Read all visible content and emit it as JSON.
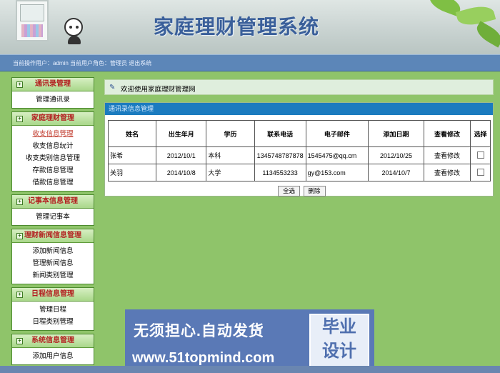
{
  "header": {
    "title": "家庭理财管理系统"
  },
  "status_bar": {
    "text": "当前操作用户：admin 当前用户角色：管理员 退出系统"
  },
  "menu": [
    {
      "title": "通讯录管理",
      "toggle": "+",
      "items": [
        "管理通讯录"
      ]
    },
    {
      "title": "家庭理财管理",
      "toggle": "+",
      "items": [
        "收支信息管理",
        "收支信息统计",
        "收支类别信息管理",
        "存款信息管理",
        "借款信息管理"
      ]
    },
    {
      "title": "记事本信息管理",
      "toggle": "+",
      "items": [
        "管理记事本"
      ]
    },
    {
      "title": "理财新闻信息管理",
      "toggle": "+",
      "items": [
        "添加新闻信息",
        "管理新闻信息",
        "新闻类别管理"
      ]
    },
    {
      "title": "日程信息管理",
      "toggle": "+",
      "items": [
        "管理日程",
        "日程类别管理"
      ]
    },
    {
      "title": "系统信息管理",
      "toggle": "+",
      "items": [
        "添加用户信息"
      ]
    }
  ],
  "welcome": {
    "icon": "book-icon",
    "text": "欢迎使用家庭理财管理网"
  },
  "panel": {
    "title": "通讯录信息管理",
    "columns": [
      "姓名",
      "出生年月",
      "学历",
      "联系电话",
      "电子邮件",
      "添加日期",
      "查看修改",
      "选择"
    ],
    "rows": [
      [
        "张希",
        "2012/10/1",
        "本科",
        "134574878787​8",
        "1545475@qq.cm",
        "2012/10/25",
        "查看修改"
      ],
      [
        "关羽",
        "2014/10/8",
        "大学",
        "1134553233",
        "gy@153.com",
        "2014/10/7",
        "查看修改"
      ]
    ],
    "select_all": "全选",
    "delete": "删除"
  },
  "ad": {
    "line1": "无须担心.自动发货",
    "line2": "www.51topmind.com",
    "box1": "毕业",
    "box2": "设计"
  },
  "colors": {
    "background": "#8fc46a",
    "panel_header": "#1b7bbf",
    "title": "#3a5f9a"
  }
}
